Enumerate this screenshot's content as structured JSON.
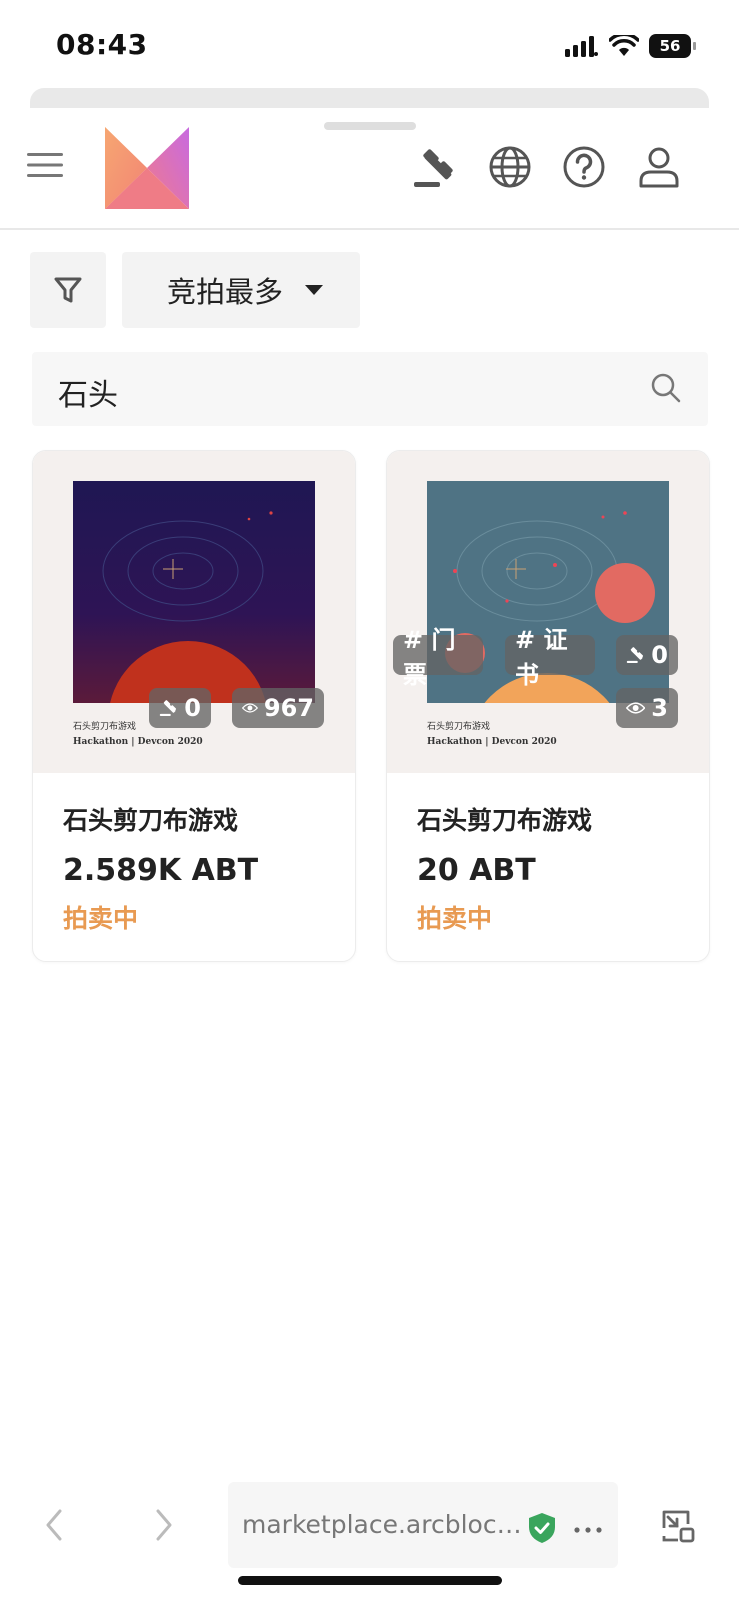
{
  "status_bar": {
    "time": "08:43",
    "battery": "56"
  },
  "header": {
    "logo_name": "m-logo",
    "icons": [
      "menu-icon",
      "auction-gavel-icon",
      "globe-icon",
      "help-icon",
      "user-icon"
    ]
  },
  "filters": {
    "sort_label": "竞拍最多"
  },
  "search": {
    "value": "石头"
  },
  "items": [
    {
      "art_caption_line1": "石头剪刀布游戏",
      "art_caption_line2": "Hackathon | Devcon 2020",
      "bids": "0",
      "views": "967",
      "tags": [],
      "title": "石头剪刀布游戏",
      "price": "2.589K ABT",
      "status": "拍卖中"
    },
    {
      "art_caption_line1": "石头剪刀布游戏",
      "art_caption_line2": "Hackathon | Devcon 2020",
      "bids": "0",
      "views": "3",
      "tags": [
        "# 门票",
        "# 证书"
      ],
      "title": "石头剪刀布游戏",
      "price": "20 ABT",
      "status": "拍卖中"
    }
  ],
  "browser": {
    "url": "marketplace.arcbloc…"
  },
  "colors": {
    "accent_orange": "#e89a52",
    "chip_bg": "#646464",
    "shield_green": "#3aa55d"
  }
}
